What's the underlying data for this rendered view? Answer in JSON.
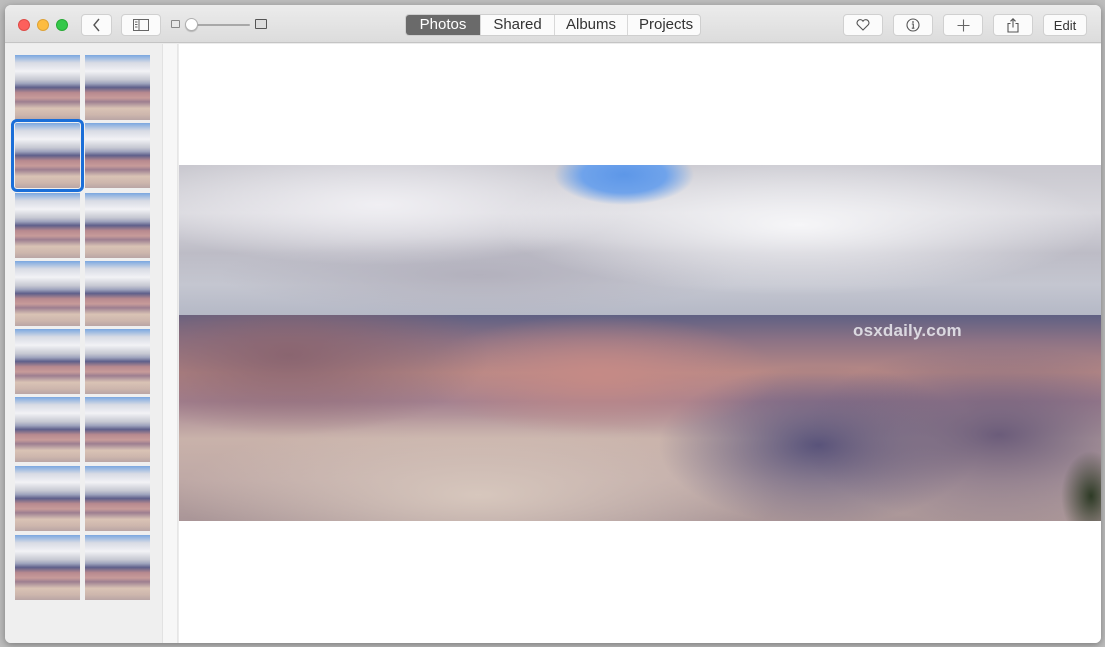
{
  "window": {
    "controls": [
      "close",
      "minimize",
      "zoom"
    ]
  },
  "toolbar": {
    "back_icon": "chevron-left-icon",
    "sidebar_toggle_icon": "sidebar-icon",
    "zoom_slider": {
      "value": 0.0
    },
    "tabs": [
      {
        "label": "Photos",
        "active": true
      },
      {
        "label": "Shared",
        "active": false
      },
      {
        "label": "Albums",
        "active": false
      },
      {
        "label": "Projects",
        "active": false
      }
    ],
    "favorite_icon": "heart-icon",
    "info_icon": "info-icon",
    "add_icon": "plus-icon",
    "add_label": "+",
    "share_icon": "share-icon",
    "edit_label": "Edit"
  },
  "sidebar": {
    "thumbnail_count": 16,
    "selected_index": 2
  },
  "viewer": {
    "watermark": "osxdaily.com"
  },
  "colors": {
    "selection": "#1a6ed8",
    "active_tab": "#6a6a6a"
  }
}
